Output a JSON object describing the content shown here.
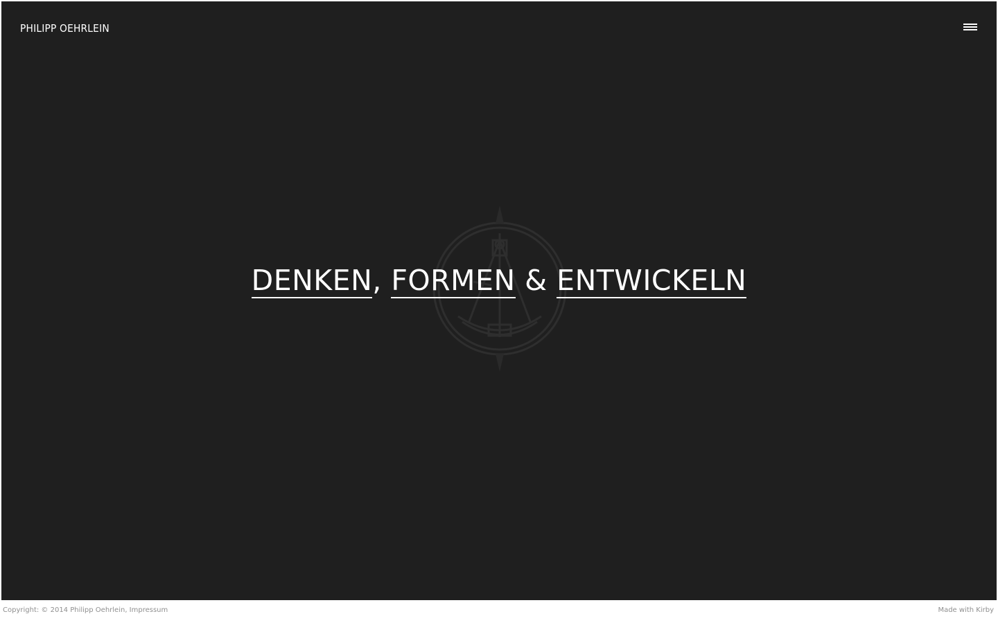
{
  "header": {
    "brand": "PHILIPP OEHRLEIN",
    "menu_icon": "hamburger-menu-icon"
  },
  "hero": {
    "word1": "DENKEN",
    "sep1": ", ",
    "word2": "FORMEN",
    "sep2": " & ",
    "word3": "ENTWICKELN",
    "emblem_icon": "compass-sextant-emblem-icon"
  },
  "footer": {
    "copyright_text": "Copyright: © 2014 Philipp Oehrlein, ",
    "impressum_link": "Impressum",
    "made_with": "Made with Kirby"
  },
  "colors": {
    "background": "#1f1f1f",
    "text": "#ffffff",
    "footer_text": "#8f8f8f"
  }
}
